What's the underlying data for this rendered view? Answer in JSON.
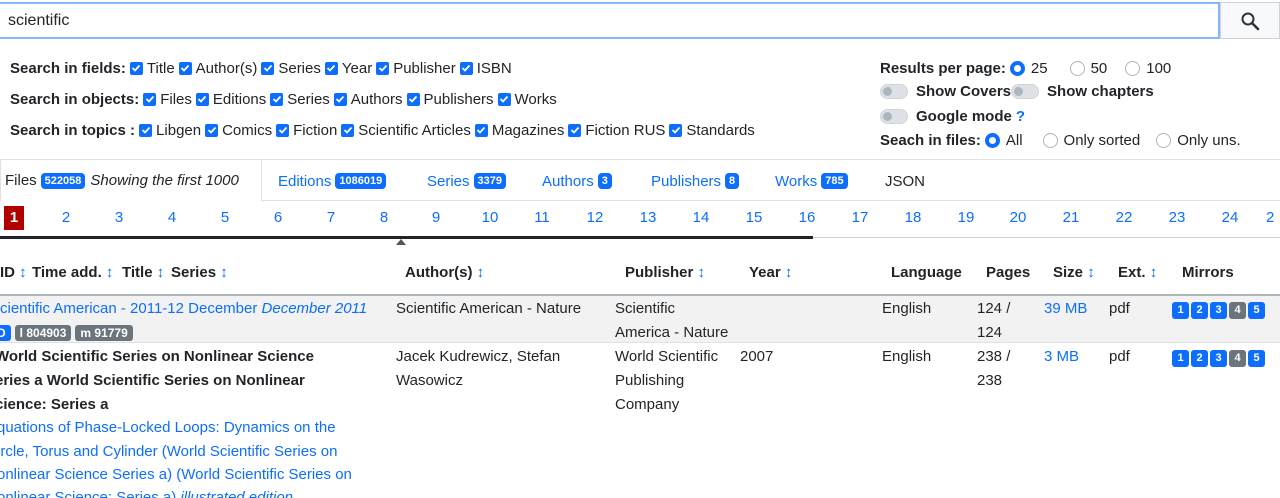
{
  "search": {
    "value": "scientific"
  },
  "fields": {
    "label": "Search in fields:",
    "items": [
      "Title",
      "Author(s)",
      "Series",
      "Year",
      "Publisher",
      "ISBN"
    ]
  },
  "objects": {
    "label": "Search in objects:",
    "items": [
      "Files",
      "Editions",
      "Series",
      "Authors",
      "Publishers",
      "Works"
    ]
  },
  "topics": {
    "label": "Search in topics :",
    "items": [
      "Libgen",
      "Comics",
      "Fiction",
      "Scientific Articles",
      "Magazines",
      "Fiction RUS",
      "Standards"
    ]
  },
  "results_per_page": {
    "label": "Results per page:",
    "options": [
      "25",
      "50",
      "100"
    ],
    "selected": "25"
  },
  "toggles": {
    "show_covers": "Show Covers",
    "show_chapters": "Show chapters",
    "google_mode": "Google mode",
    "google_help": "?"
  },
  "search_in_files": {
    "label": "Seach in files:",
    "options": [
      "All",
      "Only sorted",
      "Only uns."
    ],
    "selected": "All"
  },
  "tabs": {
    "files": {
      "label": "Files",
      "count": "522058",
      "note": "Showing the first 1000"
    },
    "editions": {
      "label": "Editions",
      "count": "1086019"
    },
    "series": {
      "label": "Series",
      "count": "3379"
    },
    "authors": {
      "label": "Authors",
      "count": "3"
    },
    "publishers": {
      "label": "Publishers",
      "count": "8"
    },
    "works": {
      "label": "Works",
      "count": "785"
    },
    "json": {
      "label": "JSON"
    }
  },
  "pagination": {
    "current": "1",
    "pages": [
      "2",
      "3",
      "4",
      "5",
      "6",
      "7",
      "8",
      "9",
      "10",
      "11",
      "12",
      "13",
      "14",
      "15",
      "16",
      "17",
      "18",
      "19",
      "20",
      "21",
      "22",
      "23",
      "24",
      "2"
    ]
  },
  "table": {
    "headers": {
      "id": "ID",
      "time_added": "Time add.",
      "title": "Title",
      "series": "Series",
      "authors": "Author(s)",
      "publisher": "Publisher",
      "year": "Year",
      "language": "Language",
      "pages": "Pages",
      "size": "Size",
      "ext": "Ext.",
      "mirrors": "Mirrors",
      "sort_icon": "↕"
    },
    "rows": [
      {
        "title_link": "cientific American - 2011-12 December",
        "title_italic": "December 2011",
        "tags": [
          "D",
          "l 804903",
          "m 91779"
        ],
        "authors": "Scientific American - Nature",
        "publisher_line1": "Scientific",
        "publisher_line2": "America - Nature",
        "year": "",
        "language": "English",
        "pages_line1": "124 /",
        "pages_line2": "124",
        "size": "39 MB",
        "ext": "pdf",
        "mirrors": [
          "1",
          "2",
          "3",
          "4",
          "5"
        ]
      },
      {
        "series_line1": "World Scientific Series on Nonlinear Science",
        "series_line2": "eries a World Scientific Series on Nonlinear",
        "series_line3": "cience: Series a",
        "title_line1": "quations of Phase-Locked Loops: Dynamics on the",
        "title_line2": "ircle, Torus and Cylinder (World Scientific Series on",
        "title_line3": "onlinear Science Series a) (World Scientific Series on",
        "title_line4": "onlinear Science: Series a)",
        "title_italic": "illustrated edition",
        "authors_line1": "Jacek Kudrewicz, Stefan",
        "authors_line2": "Wasowicz",
        "publisher_line1": "World Scientific",
        "publisher_line2": "Publishing",
        "publisher_line3": "Company",
        "year": "2007",
        "language": "English",
        "pages_line1": "238 /",
        "pages_line2": "238",
        "size": "3 MB",
        "ext": "pdf",
        "mirrors": [
          "1",
          "2",
          "3",
          "4",
          "5"
        ]
      }
    ]
  },
  "colors": {
    "accent": "#0d6efd",
    "current_page": "#b00000",
    "tag_grey": "#6c757d"
  }
}
